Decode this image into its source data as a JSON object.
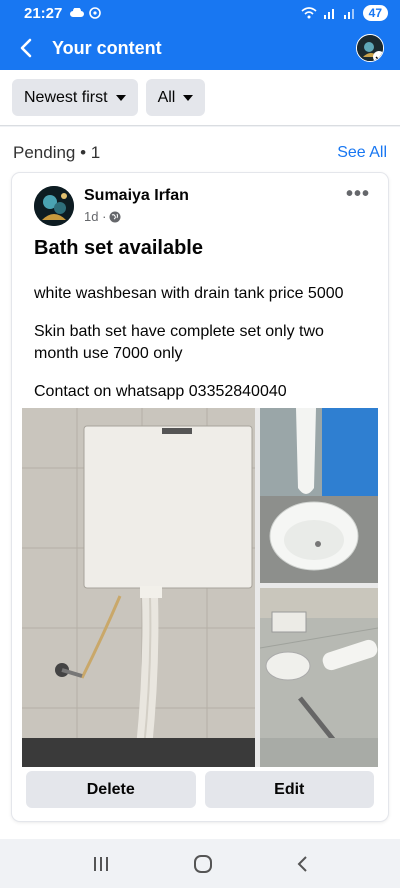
{
  "status_bar": {
    "time": "21:27",
    "battery": "47"
  },
  "header": {
    "title": "Your content"
  },
  "filters": {
    "sort": "Newest first",
    "type": "All"
  },
  "section": {
    "label": "Pending • 1",
    "see_all": "See All"
  },
  "post": {
    "author": "Sumaiya Irfan",
    "time": "1d ·",
    "title": "Bath set available",
    "lines": [
      "white washbesan with drain tank price 5000",
      "Skin bath set have complete set only two",
      "month use 7000 only",
      "Contact on whatsapp 03352840040"
    ]
  },
  "actions": {
    "delete": "Delete",
    "edit": "Edit"
  },
  "colors": {
    "brand": "#1877f2",
    "chip": "#e4e6eb"
  }
}
